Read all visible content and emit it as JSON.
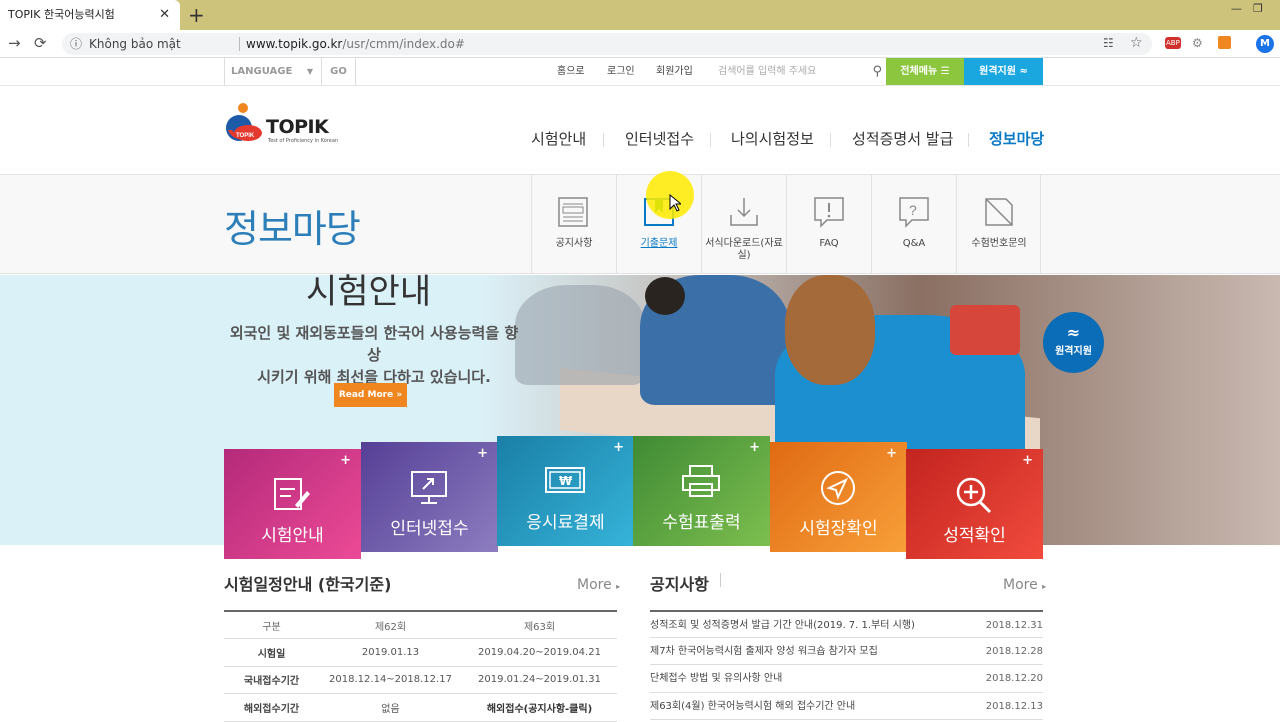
{
  "browser": {
    "tab_title": "TOPIK 한국어능력시험",
    "close_glyph": "✕",
    "new_tab_glyph": "+",
    "security_text": "Không bảo mật",
    "url_host": "www.topik.go.kr",
    "url_path": "/usr/cmm/index.do#",
    "avatar_letter": "M",
    "ext_abp": "ABP"
  },
  "utility": {
    "language_label": "LANGUAGE",
    "go_label": "GO",
    "links": [
      "홈으로",
      "로그인",
      "회원가입"
    ],
    "search_placeholder": "검색어를 입력해 주세요",
    "all_menu_label": "전체메뉴",
    "remote_label": "원격지원"
  },
  "header": {
    "logo_text": "TOPIK",
    "logo_sub": "Test of Proficiency in Korean",
    "gnb": [
      "시험안내",
      "인터넷접수",
      "나의시험정보",
      "성적증명서 발급",
      "정보마당"
    ],
    "active_gnb": "정보마당"
  },
  "submenu": {
    "title": "정보마당",
    "items": [
      "공지사항",
      "기출문제",
      "서식다운로드(자료실)",
      "FAQ",
      "Q&A",
      "수험번호문의"
    ],
    "active": "기출문제"
  },
  "hero": {
    "title": "시험안내",
    "desc_line1": "외국인 및 재외동포들의 한국어 사용능력을 향상",
    "desc_line2": "시키기 위해 최선을 다하고 있습니다.",
    "read_more": "Read More",
    "remote_label": "원격지원"
  },
  "tiles": [
    {
      "label": "시험안내",
      "color": "#d4357f",
      "icon": "form-edit-icon"
    },
    {
      "label": "인터넷접수",
      "color": "#6e5aa6",
      "icon": "monitor-icon"
    },
    {
      "label": "응시료결제",
      "color": "#1f8fb6",
      "icon": "won-bill-icon"
    },
    {
      "label": "수험표출력",
      "color": "#5a9e3d",
      "icon": "printer-icon"
    },
    {
      "label": "시험장확인",
      "color": "#f07e1c",
      "icon": "navigation-icon"
    },
    {
      "label": "성적확인",
      "color": "#e0372f",
      "icon": "zoom-in-icon"
    }
  ],
  "schedule": {
    "title": "시험일정안내 (한국기준)",
    "more": "More",
    "headers": [
      "구분",
      "제62회",
      "제63회"
    ],
    "rows": [
      [
        "시험일",
        "2019.01.13",
        "2019.04.20~2019.04.21"
      ],
      [
        "국내접수기간",
        "2018.12.14~2018.12.17",
        "2019.01.24~2019.01.31"
      ],
      [
        "해외접수기간",
        "없음",
        "해외접수(공지사항-클릭)"
      ]
    ]
  },
  "notices": {
    "title": "공지사항",
    "more": "More",
    "items": [
      {
        "text": "성적조회 및 성적증명서 발급 기간 안내(2019. 7. 1.부터 시행)",
        "date": "2018.12.31"
      },
      {
        "text": "제7차 한국어능력시험 출제자 양성 워크숍 참가자 모집",
        "date": "2018.12.28"
      },
      {
        "text": "단체접수 방법 및 유의사항 안내",
        "date": "2018.12.20"
      },
      {
        "text": "제63회(4월) 한국어능력시험 해외 접수기간 안내",
        "date": "2018.12.13"
      }
    ]
  }
}
